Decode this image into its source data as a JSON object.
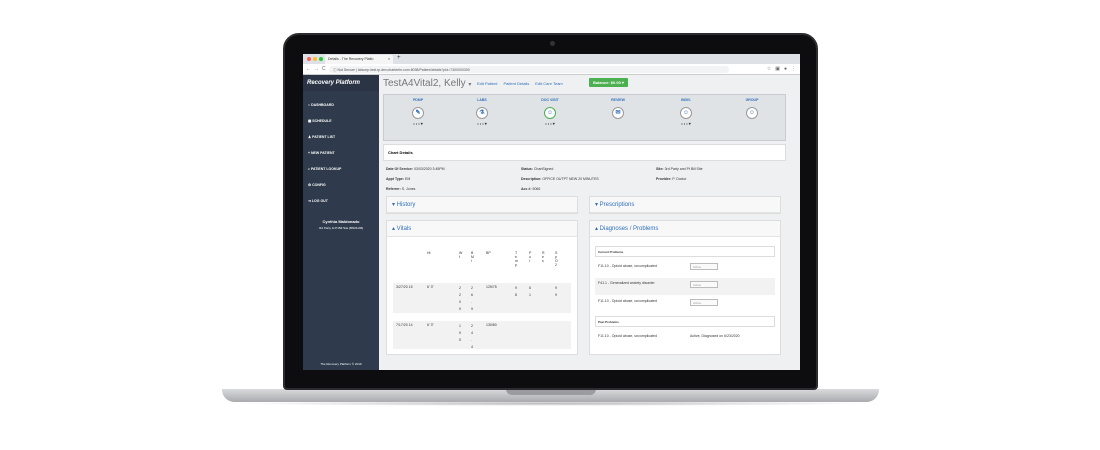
{
  "browser": {
    "tab_title": "Details - The Recovery Platfo",
    "tab_close": "×",
    "new_tab": "+",
    "nav": [
      "←",
      "→",
      "C"
    ],
    "security": "ⓘ Not Secure",
    "url": "labcorp-test.rp.dev.charteehr.com:8098/Patient/details?pId=7300000300"
  },
  "app": {
    "logo": "Recovery Platform",
    "nav_items": [
      "DASHBOARD",
      "SCHEDULE",
      "PATIENT LIST",
      "NEW PATIENT",
      "PATIENT LOOKUP",
      "CONFIG",
      "LOG OUT"
    ],
    "user_name": "Cynthia Maldonado",
    "user_site": "3rd Party & Pt Bill Site [BN01106]",
    "copyright": "The Recovery Platform © 2019"
  },
  "patient": {
    "name": "TestA4Vital2, Kelly",
    "links": [
      "Edit Patient",
      "Patient Details",
      "Edit Care Team"
    ],
    "balance": "Balance: $0.00 ▾"
  },
  "tracker": [
    {
      "label": "PDMP",
      "icon": "✎",
      "dd": "• • •  ▾"
    },
    {
      "label": "LABS",
      "icon": "⚗",
      "dd": "• • •  ▾"
    },
    {
      "label": "DOC VISIT",
      "icon": "☺",
      "dd": "• • •  ▾"
    },
    {
      "label": "REVIEW",
      "icon": "✉",
      "dd": ""
    },
    {
      "label": "INDIV.",
      "icon": "☺",
      "dd": "• • •  ▾"
    },
    {
      "label": "GROUP",
      "icon": "☺",
      "dd": ""
    }
  ],
  "chart_details": {
    "title": "Chart Details",
    "date_label": "Date Of Service:",
    "date_value": "03/03/2020 3:45PM",
    "appt_label": "Appt Type:",
    "appt_value": "EM",
    "referrer_label": "Referrer:",
    "referrer_value": "S. Jones",
    "status_label": "Status:",
    "status_value": "ChartSigned",
    "desc_label": "Description:",
    "desc_value": "OFFICE OUTPT NEW 20 MINUTES",
    "acc_label": "Acc #:",
    "acc_value": "5066",
    "site_label": "Site:",
    "site_value": "3rd Party and Pt Bill Site",
    "provider_label": "Provider:",
    "provider_value": "P. Doctor"
  },
  "panels": {
    "history": "▾ History",
    "vitals": "▴ Vitals",
    "prescriptions": "▾ Prescriptions",
    "diagnoses": "▴ Diagnoses / Problems"
  },
  "vitals": {
    "headers": [
      "Ht",
      "W t",
      "B M I",
      "BP",
      "T e m p",
      "P u l",
      "R e s",
      "S p O 2"
    ],
    "rows": [
      {
        "date": "3/27/20 15",
        "ht": "6' 3\"",
        "wt": "2 2 0 9",
        "bmi": "2 6 . 9",
        "bp": "125/75",
        "temp": "9 8",
        "pul": "6 1",
        "res": "",
        "spo2": "9 9"
      },
      {
        "date": "7/17/20 14",
        "ht": "6' 3\"",
        "wt": "1 9 5",
        "bmi": "2 4 . 4",
        "bp": "130/80",
        "temp": "",
        "pul": "",
        "res": "",
        "spo2": ""
      }
    ]
  },
  "diagnoses": {
    "current_header": "Current Problems",
    "current": [
      {
        "name": "F11.10 - Opioid abuse, uncomplicated",
        "status": "Active"
      },
      {
        "name": "F41.1 - Generalized anxiety disorder",
        "status": "Active"
      },
      {
        "name": "F11.10 - Opioid abuse, uncomplicated",
        "status": "Active"
      }
    ],
    "past_header": "Past Problems",
    "past": [
      {
        "name": "F11.10 - Opioid abuse, uncomplicated",
        "status": "Active, Diagnosed on 6/23/2020"
      }
    ]
  }
}
